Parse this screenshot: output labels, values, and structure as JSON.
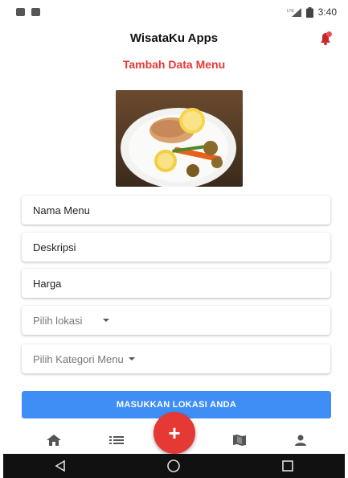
{
  "status_bar": {
    "time": "3:40",
    "network_label": "LTE"
  },
  "app_bar": {
    "title": "WisataKu Apps"
  },
  "page": {
    "title": "Tambah Data Menu"
  },
  "form": {
    "name_value": "Nama Menu",
    "description_value": "Deskripsi",
    "price_value": "Harga",
    "location_select": "Pilih lokasi",
    "category_select": "Pilih Kategori Menu",
    "submit_label": "MASUKKAN LOKASI ANDA"
  },
  "fab": {
    "label": "+"
  },
  "bottom_nav": {
    "icons": [
      "home-icon",
      "list-icon",
      "map-icon",
      "person-icon"
    ]
  },
  "colors": {
    "accent": "#e53935",
    "primary": "#3f8ef5",
    "nav_icon": "#555555"
  }
}
